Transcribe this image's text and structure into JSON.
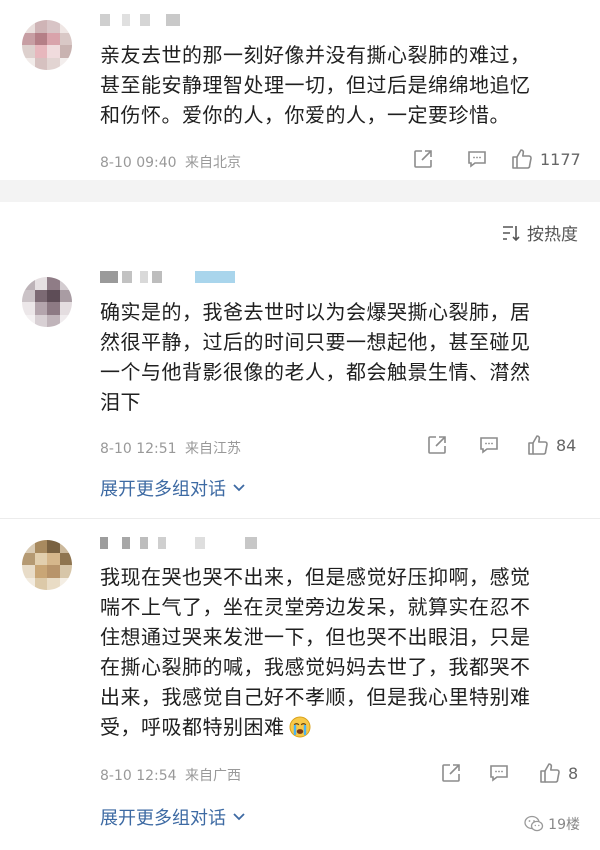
{
  "sort": {
    "label": "按热度",
    "icon": "sort-icon"
  },
  "comments": [
    {
      "lines": [
        "亲友去世的那一刻好像并没有撕心裂肺的难过，",
        "甚至能安静理智处理一切，但过后是绵绵地追忆",
        "和伤怀。爱你的人，你爱的人，一定要珍惜。"
      ],
      "time": "8-10 09:40",
      "location": "来自北京",
      "likes": "1177"
    },
    {
      "lines": [
        "确实是的，我爸去世时以为会爆哭撕心裂肺，居",
        "然很平静，过后的时间只要一想起他，甚至碰见",
        "一个与他背影很像的老人，都会触景生情、潸然",
        "泪下"
      ],
      "time": "8-10 12:51",
      "location": "来自江苏",
      "likes": "84",
      "expand": "展开更多组对话"
    },
    {
      "lines": [
        "我现在哭也哭不出来，但是感觉好压抑啊，感觉",
        "喘不上气了，坐在灵堂旁边发呆，就算实在忍不",
        "住想通过哭来发泄一下，但也哭不出眼泪，只是",
        "在撕心裂肺的喊，我感觉妈妈去世了，我都哭不",
        "出来，我感觉自己好不孝顺，但是我心里特别难",
        "受，呼吸都特别困难"
      ],
      "emoji": "crying-face-icon",
      "time": "8-10 12:54",
      "location": "来自广西",
      "likes": "8",
      "expand": "展开更多组对话"
    }
  ],
  "watermark": {
    "label": "19楼"
  },
  "colors": {
    "link": "#3d6aa3",
    "meta": "#999999",
    "band": "#f3f3f3"
  }
}
